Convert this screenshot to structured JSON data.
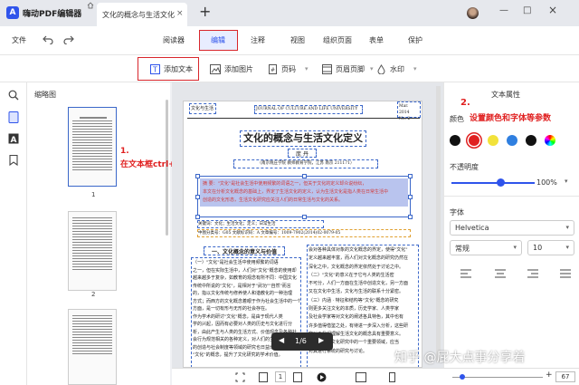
{
  "titlebar": {
    "app_name": "嗨动PDF编辑器",
    "doc_tab_title": "文化的概念与生活文化...",
    "close_glyph": "×",
    "new_tab_glyph": "+",
    "window_minimize": "—",
    "window_maximize": "□",
    "window_close": "×"
  },
  "menubar": {
    "file": "文件",
    "tabs": [
      "阅读器",
      "编辑",
      "注释",
      "视图",
      "组织页面",
      "表单",
      "保护"
    ],
    "active_tab": "编辑"
  },
  "toolbar": {
    "add_text": "添加文本",
    "add_image": "添加图片",
    "page_number": "页码",
    "header_footer": "页眉页脚",
    "watermark": "水印"
  },
  "thumbnails": {
    "title": "缩略图",
    "pages": [
      "1",
      "2"
    ]
  },
  "annotations": {
    "step1_number": "1.",
    "step1_text": "在文本框ctrl+A全选框内文本",
    "step2_number": "2.",
    "step2_text": "设置颜色和字体等参数"
  },
  "document": {
    "header_left": "文化与生活",
    "header_center": "JOURNAL OF CULTURE AND LIFE UNIVERSITY",
    "header_right_line1": "Mar. 2014",
    "header_right_line2": "No. 2",
    "title": "文化的概念与生活文化定义",
    "author": "庞  丹",
    "affiliation": "（南京晓庄学院  教师教育学院，江苏  南京  211171）",
    "abstract_line1": "摘  要：\"文化\"是社会生活中使用频繁的词语之一，但关于文化的定义却众说纷纭，",
    "abstract_line2": "本文在分析文化概念的基础上，界定了生活文化的定义，认为生活文化是指人类在日常生活中",
    "abstract_line3": "创造的文化形态，生活文化研究应关注人们的日常生活与文化的关系。",
    "keywords": "关键词：文化；生活文化；定义；日常生活",
    "classification": "中图分类号：G05    文献标识码：A    文章编号：1009-7902(2014)02-0079-05",
    "section_heading": "一、文化概念的意义与价值",
    "left_col": [
      "（一）\"文化\"是社会生活中使用频繁的词语",
      "之一，但在实际生活中，人们对\"文化\"概念的使用却",
      "越来越多于复杂，如教育的观念有所不同：中国文化",
      "传统中所说的\"文化\"，是相对于\"武功\"\"自然\"而言",
      "的，指以文化传统与修养使人和谐教化的一种治理",
      "方式；而西方的文化概念着眼于作为社会生活中的一个",
      "方面，是一切有形与无形的社会存在。",
      "作为学术的研讨\"文化\"概念，是由于现代人类",
      "学的兴起，因而有必要对人类的历史与文化进行分",
      "析，由此产生与人类的生活方式、价值观念及各种社",
      "会行为规范相关的各种定义，对人们的生活方式、精神",
      "的创造与社会制度等领域的研究也日益增多，形成了",
      "\"文化\"的概念，提升了文化研究的学术价值。"
    ],
    "right_col": [
      "会对各种具体对象的文化概念的界定，使得\"文化\"",
      "定义越来越丰富，而人们对文化概念的研究仍然在",
      "深化之中，文化概念的界定依然处于讨论之中。",
      "（二）\"文化\"的意义在于它与人类的生活密",
      "不可分，人们一方面在生活中创造文化，另一方面",
      "又在文化中生活，文化与生活的联系十分紧密。",
      "（三）内涵 · 特征和结构等\"文化\"概念的研究",
      "则更多关注文化的本质，历史学家、人类学家",
      "及社会学家等对文化的阐述各具特色，其中也有",
      "许多值得借鉴之处，有待进一步深入分析，这些研",
      "究对于我们理解生活文化的概念具有重要意义。",
      "生活文化是文化研究中的一个重要领域，应当",
      "对其进行系统的研究与讨论。"
    ]
  },
  "page_nav": {
    "indicator": "1/6",
    "prev": "◀",
    "next": "▶"
  },
  "right_panel": {
    "title": "文本属性",
    "color_label": "颜色",
    "colors": [
      "#111111",
      "#e02020",
      "#f2e23a",
      "#2f7fe0",
      "#111111"
    ],
    "selected_color": "#e02020",
    "opacity_label": "不透明度",
    "opacity_value": "100%",
    "opacity_fraction": 1.0,
    "font_label": "字体",
    "font_name": "Helvetica",
    "font_style": "常规",
    "font_size": "10"
  },
  "statusbar": {
    "page_field": "1",
    "zoom_value": "67"
  },
  "watermark": "知乎 @屁大点事分享着"
}
